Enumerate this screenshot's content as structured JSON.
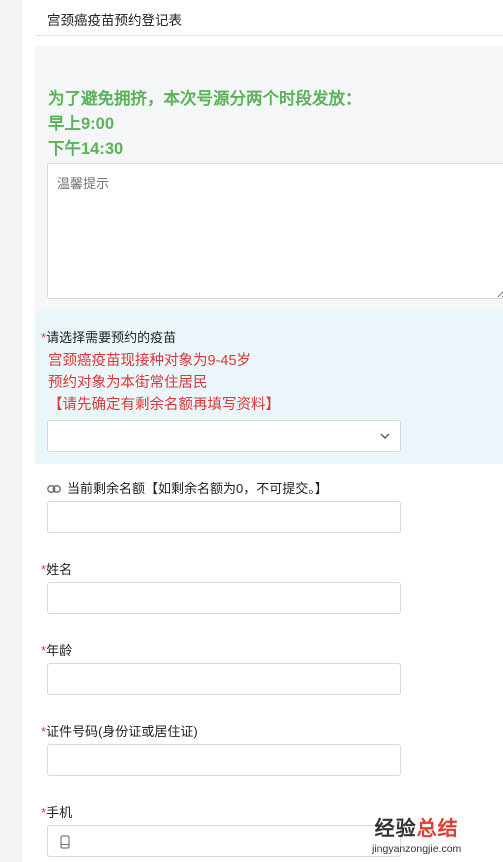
{
  "form": {
    "title": "宫颈癌疫苗预约登记表"
  },
  "notice": {
    "lines": [
      "为了避免拥挤，本次号源分两个时段发放：",
      "早上9:00",
      "下午14:30"
    ],
    "textarea_placeholder": "温馨提示"
  },
  "vaccine": {
    "required_mark": "*",
    "label": "请选择需要预约的疫苗",
    "warnings": [
      "宫颈癌疫苗现接种对象为9-45岁",
      "预约对象为本街常住居民",
      "【请先确定有剩余名额再填写资料】"
    ],
    "selected_value": ""
  },
  "remaining": {
    "label": "当前剩余名额【如剩余名额为0，不可提交。】",
    "value": ""
  },
  "fields": {
    "name": {
      "required_mark": "*",
      "label": "姓名",
      "value": ""
    },
    "age": {
      "required_mark": "*",
      "label": "年龄",
      "value": ""
    },
    "id_number": {
      "required_mark": "*",
      "label": "证件号码(身份证或居住证)",
      "value": ""
    },
    "phone": {
      "required_mark": "*",
      "label": "手机",
      "value": ""
    }
  },
  "watermark": {
    "main_prefix": "经验",
    "main_accent": "总结",
    "sub": "jingyanzongjie.com"
  },
  "colors": {
    "notice_green": "#5bb25a",
    "warning_red": "#d9383b",
    "required_red": "#e03e2d",
    "vaccine_bg": "#ebf6fa"
  }
}
